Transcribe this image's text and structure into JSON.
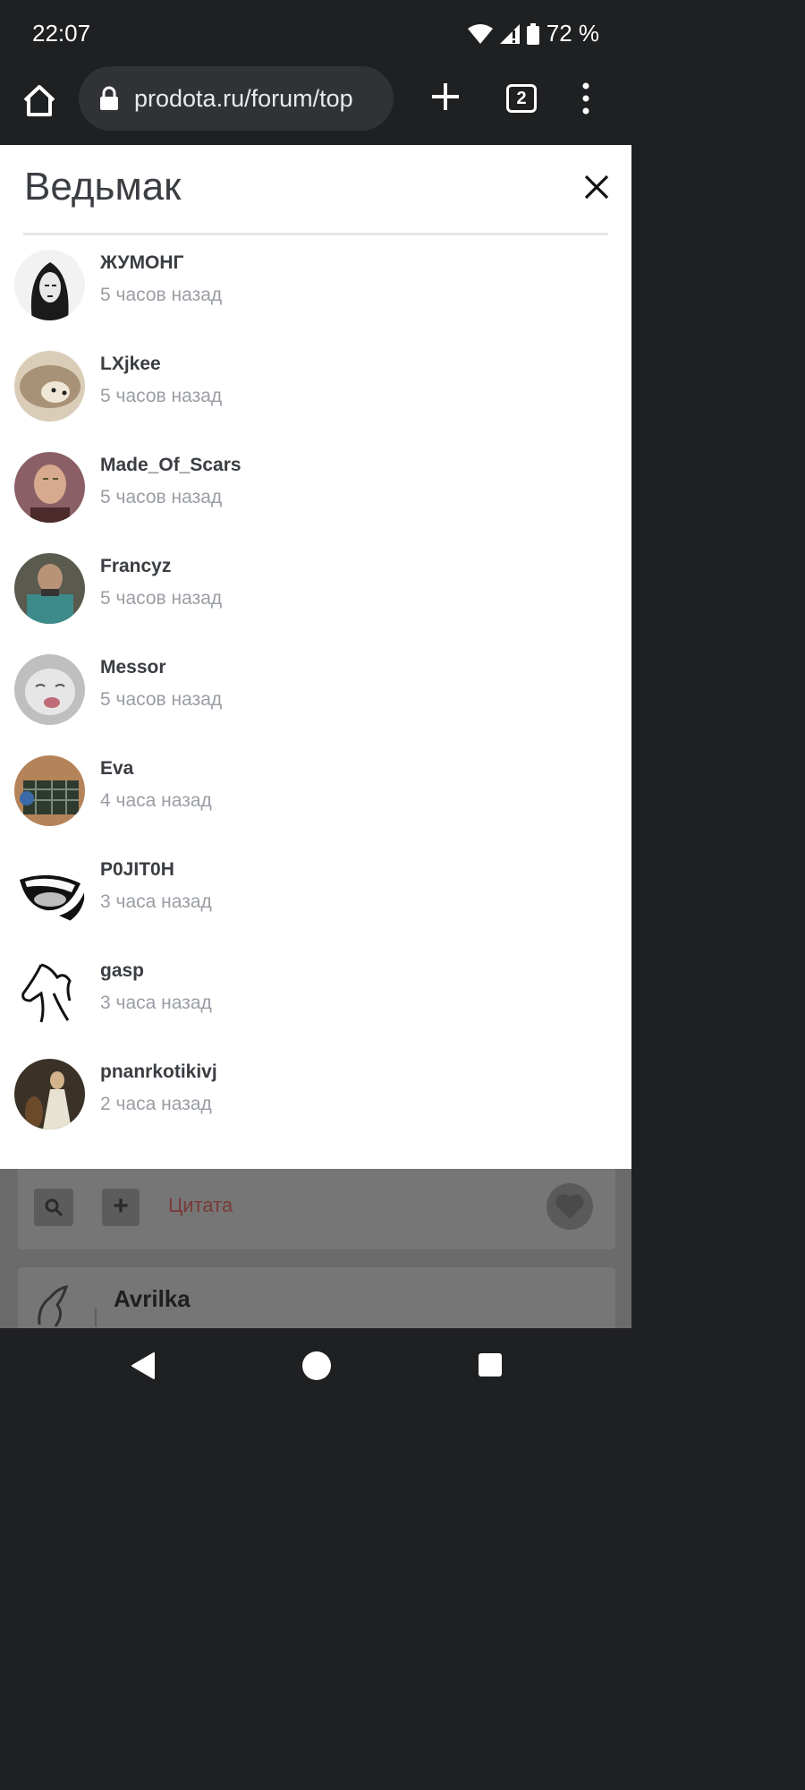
{
  "status_bar": {
    "time": "22:07",
    "battery": "72 %",
    "icons": [
      "wifi-icon",
      "signal-icon",
      "battery-icon"
    ]
  },
  "browser": {
    "url": "prodota.ru/forum/top",
    "tab_count": "2",
    "icons": [
      "home-icon",
      "lock-icon",
      "plus-icon",
      "tabs-icon",
      "more-vert-icon"
    ]
  },
  "modal": {
    "title": "Ведьмак",
    "users": [
      {
        "name": "ЖУМОНГ",
        "time": "5 часов назад"
      },
      {
        "name": "LXjkee",
        "time": "5 часов назад"
      },
      {
        "name": "Made_Of_Scars",
        "time": "5 часов назад"
      },
      {
        "name": "Francyz",
        "time": "5 часов назад"
      },
      {
        "name": "Messor",
        "time": "5 часов назад"
      },
      {
        "name": "Eva",
        "time": "4 часа назад"
      },
      {
        "name": "P0JIT0H",
        "time": "3 часа назад"
      },
      {
        "name": "gasp",
        "time": "3 часа назад"
      },
      {
        "name": "pnanrkotikivj",
        "time": "2 часа назад"
      }
    ]
  },
  "background_page": {
    "quote_label": "Цитата",
    "next_post_author": "Avrilka"
  },
  "colors": {
    "modal_bg": "#ffffff",
    "name_text": "#3a3d41",
    "time_text": "#9a9ea4",
    "chrome_bg": "#1f2022"
  }
}
